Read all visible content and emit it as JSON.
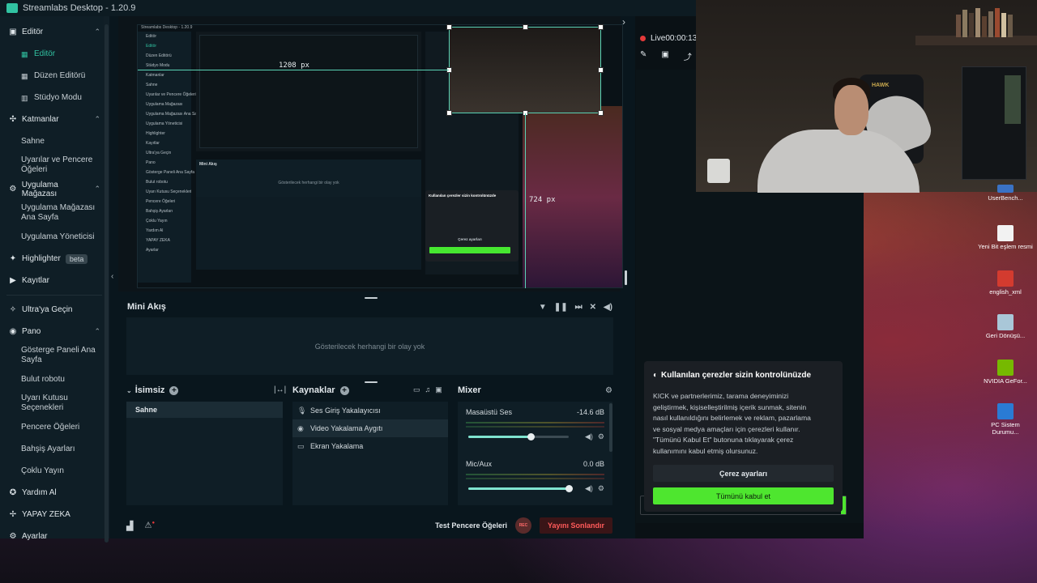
{
  "app": {
    "title": "Streamlabs Desktop - 1.20.9"
  },
  "sidebar": {
    "groups": [
      {
        "label": "Editör",
        "icon": "layout-icon",
        "items": [
          {
            "label": "Editör",
            "icon": "editor-icon",
            "active": true
          },
          {
            "label": "Düzen Editörü",
            "icon": "grid-icon"
          },
          {
            "label": "Stüdyo Modu",
            "icon": "studio-icon"
          }
        ]
      },
      {
        "label": "Katmanlar",
        "icon": "layers-icon",
        "items": [
          {
            "label": "Sahne"
          },
          {
            "label": "Uyarılar ve Pencere Öğeleri"
          }
        ]
      },
      {
        "label": "Uygulama Mağazası",
        "icon": "store-icon",
        "items": [
          {
            "label": "Uygulama Mağazası Ana Sayfa"
          },
          {
            "label": "Uygulama Yöneticisi"
          }
        ]
      }
    ],
    "highlighter": {
      "label": "Highlighter",
      "badge": "beta"
    },
    "recordings": "Kayıtlar",
    "ultra": "Ultra'ya Geçin",
    "dashboard": {
      "label": "Pano",
      "items": [
        "Gösterge Paneli Ana Sayfa",
        "Bulut robotu",
        "Uyarı Kutusu Seçenekleri",
        "Pencere Öğeleri",
        "Bahşiş Ayarları",
        "Çoklu Yayın"
      ]
    },
    "help": "Yardım Al",
    "ai": "YAPAY ZEKA",
    "settings": "Ayarlar"
  },
  "preview": {
    "measure_width": "1208 px",
    "measure_height": "724 px",
    "nested": {
      "title": "Streamlabs Desktop - 1.20.9",
      "rows": [
        "Editör",
        "Editör",
        "Düzen Editörü",
        "Stüdyo Modu",
        "Katmanlar",
        "Sahne",
        "Uyarılar ve Pencere Öğeleri",
        "Uygulama Mağazası",
        "Uygulama Mağazası Ana Sayfa",
        "Uygulama Yöneticisi",
        "Highlighter",
        "Kayıtlar",
        "Ultra'ya Geçin",
        "Pano",
        "Gösterge Paneli Ana Sayfa",
        "Bulut robotu",
        "Uyarı Kutusu Seçenekleri",
        "Pencere Öğeleri",
        "Bahşiş Ayarları",
        "Çoklu Yayın",
        "Yardım Al",
        "YAPAY ZEKA",
        "Ayarlar"
      ],
      "mini_title": "Mini Akış",
      "mini_empty": "Gösterilecek herhangi bir olay yok",
      "cookie_title": "Kullanılan çerezler sizin kontrolünüzde",
      "cookie_settings": "Çerez ayarları",
      "cookie_accept": "Tümünü kabul et"
    }
  },
  "mini_feed": {
    "title": "Mini Akış",
    "empty": "Gösterilecek herhangi bir olay yok"
  },
  "scenes": {
    "title": "İsimsiz",
    "items": [
      "Sahne"
    ]
  },
  "sources": {
    "title": "Kaynaklar",
    "items": [
      {
        "label": "Ses Giriş Yakalayıcısı",
        "icon": "mic-icon"
      },
      {
        "label": "Video Yakalama Aygıtı",
        "icon": "webcam-icon",
        "selected": true
      },
      {
        "label": "Ekran Yakalama",
        "icon": "monitor-icon"
      }
    ]
  },
  "mixer": {
    "title": "Mixer",
    "channels": [
      {
        "name": "Masaüstü Ses",
        "db": "-14.6 dB",
        "level": 0.62
      },
      {
        "name": "Mic/Aux",
        "db": "0.0 dB",
        "level": 1.0
      }
    ]
  },
  "footer": {
    "test_widgets": "Test Pencere Öğeleri",
    "rec": "REC",
    "end_stream": "Yayını Sonlandır"
  },
  "right_panel": {
    "live_label": "Live",
    "live_time": "00:00:13"
  },
  "cookie": {
    "title": "Kullanılan çerezler sizin kontrolünüzde",
    "body_lines": [
      "KICK ve partnerlerimiz, tarama deneyiminizi",
      "geliştirmek, kişiselleştirilmiş içerik sunmak, sitenin",
      "nasıl kullanıldığını belirlemek ve reklam, pazarlama",
      "ve sosyal medya amaçları için çerezleri kullanır.",
      "\"Tümünü Kabul Et\" butonuna tıklayarak çerez",
      "kullanımını kabul etmiş olursunuz."
    ],
    "settings_button": "Çerez ayarları",
    "accept_button": "Tümünü kabul et"
  },
  "webcam": {
    "chair_brand": "HAWK"
  },
  "desktop_icons": [
    {
      "label": "UserBench...",
      "color": "#3a72c4"
    },
    {
      "label": "Yeni Bit eşlem resmi",
      "color": "#f2f2f2"
    },
    {
      "label": "english_xml",
      "color": "#d33b2f"
    },
    {
      "label": "Geri Dönüşü...",
      "color": "#a9c7d8"
    },
    {
      "label": "NVIDIA GeFor...",
      "color": "#76b900"
    },
    {
      "label": "PC Sistem Durumu...",
      "color": "#2a7bd4"
    }
  ]
}
